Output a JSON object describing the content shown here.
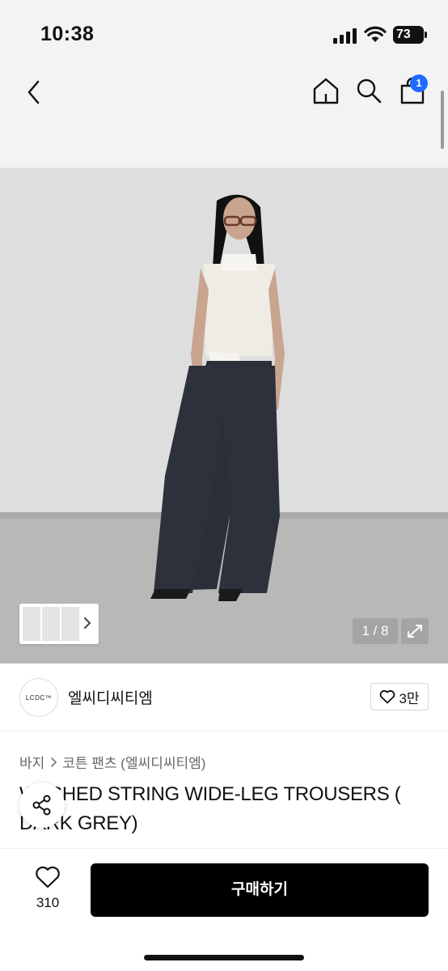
{
  "status_bar": {
    "time": "10:38",
    "battery_level": "73",
    "icons": [
      "signal-icon",
      "wifi-icon",
      "battery-icon"
    ]
  },
  "nav": {
    "icons": [
      "back-icon",
      "home-icon",
      "search-icon",
      "shopping-bag-icon"
    ],
    "cart_badge": "1"
  },
  "gallery": {
    "counter": "1 / 8",
    "icons": [
      "chevron-right-icon",
      "expand-icon"
    ]
  },
  "brand": {
    "logo_text": "LCDC™",
    "name": "엘씨디씨티엠",
    "like_count": "3만",
    "icons": [
      "heart-icon"
    ]
  },
  "breadcrumb": {
    "category": "바지",
    "subcategory": "코튼 팬츠 (엘씨디씨티엠)",
    "icons": [
      "chevron-right-icon"
    ]
  },
  "product": {
    "title": "WASHED STRING WIDE-LEG TROUSERS ( DARK GREY)"
  },
  "share": {
    "icon": "share-icon"
  },
  "bottom_bar": {
    "wish_count": "310",
    "buy_label": "구매하기",
    "icons": [
      "heart-icon"
    ]
  },
  "colors": {
    "accent_badge": "#1f6bff",
    "buy_button": "#000000",
    "header_bg": "#f3f3f3"
  }
}
